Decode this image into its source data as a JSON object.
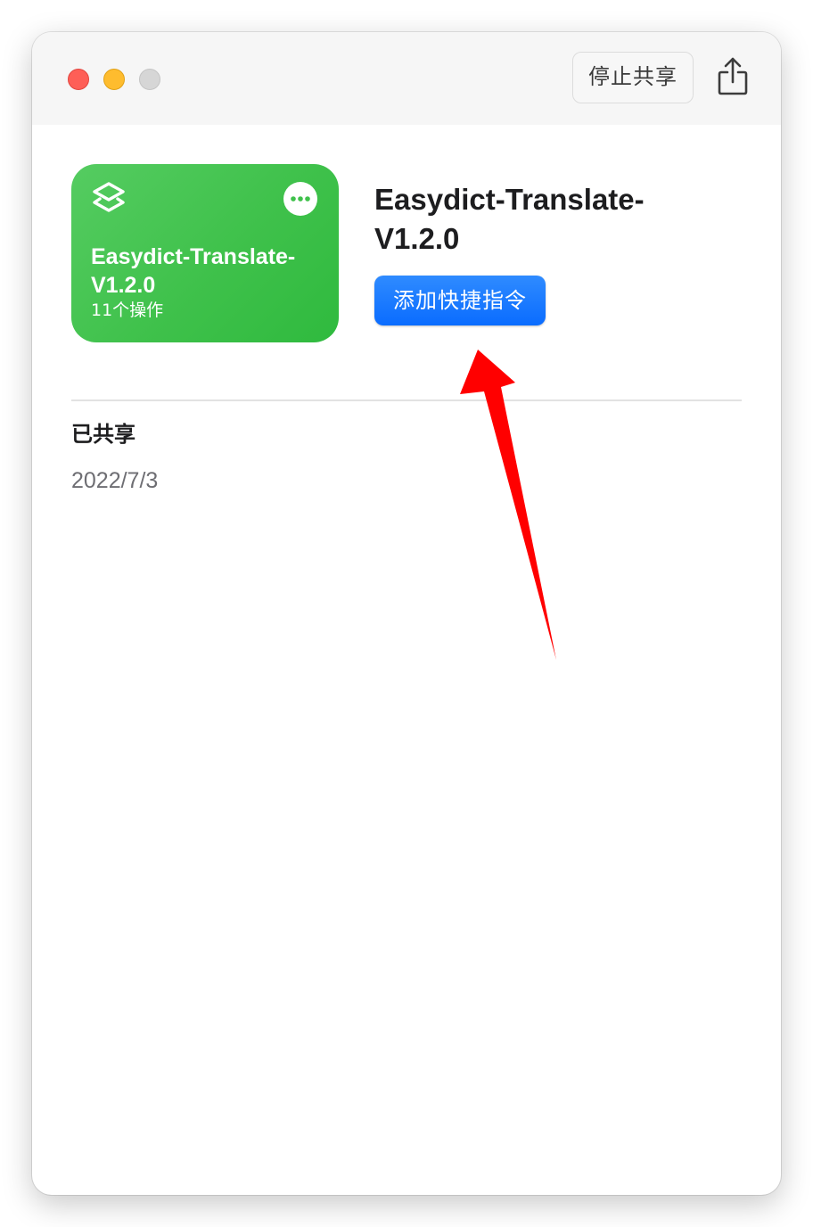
{
  "window": {
    "controls": {
      "close": "close-window",
      "minimize": "minimize-window",
      "zoom": "zoom-window"
    },
    "toolbar": {
      "stop_share_label": "停止共享",
      "share_icon": "share-icon"
    }
  },
  "shortcut_card": {
    "color": "#3fc14b",
    "icon": "shortcuts-icon",
    "more_icon": "more-icon",
    "title": "Easydict-Translate-\nV1.2.0",
    "subtitle": "11个操作"
  },
  "detail": {
    "title": "Easydict-Translate-\nV1.2.0",
    "add_button_label": "添加快捷指令",
    "accent": "#0a6cff"
  },
  "shared_section": {
    "label": "已共享",
    "date": "2022/7/3"
  },
  "annotation": {
    "arrow_color": "#ff0000"
  }
}
